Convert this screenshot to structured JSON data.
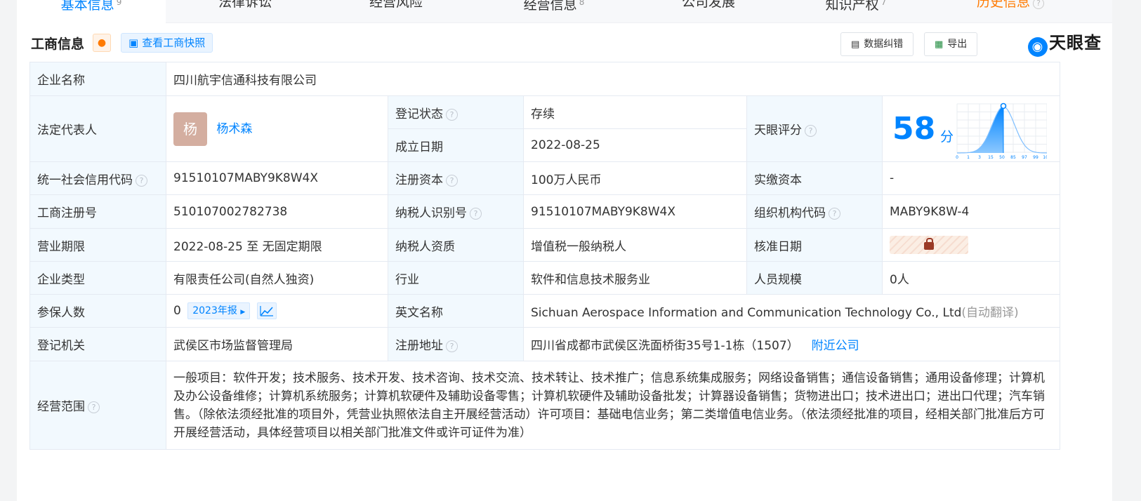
{
  "tabs": [
    {
      "label": "基本信息",
      "count": "9"
    },
    {
      "label": "法律诉讼",
      "count": ""
    },
    {
      "label": "经营风险",
      "count": ""
    },
    {
      "label": "经营信息",
      "count": "8"
    },
    {
      "label": "公司发展",
      "count": ""
    },
    {
      "label": "知识产权",
      "count": "7"
    },
    {
      "label": "历史信息",
      "count": ""
    }
  ],
  "header": {
    "title": "工商信息",
    "snapshot_label": "查看工商快照",
    "correct_label": "数据纠错",
    "export_label": "导出",
    "logo_text": "天眼查"
  },
  "help_glyph": "?",
  "rows": {
    "company_name": {
      "label": "企业名称",
      "value": "四川航宇信通科技有限公司"
    },
    "legal_rep": {
      "label": "法定代表人",
      "avatar_char": "杨",
      "name": "杨术森"
    },
    "reg_status": {
      "label": "登记状态",
      "value": "存续"
    },
    "found_date": {
      "label": "成立日期",
      "value": "2022-08-25"
    },
    "tianyan_score": {
      "label": "天眼评分",
      "score": "58",
      "unit": "分",
      "ticks": [
        "0",
        "1",
        "3",
        "15",
        "50",
        "85",
        "97",
        "99",
        "100"
      ]
    },
    "credit_code": {
      "label": "统一社会信用代码",
      "value": "91510107MABY9K8W4X"
    },
    "reg_capital": {
      "label": "注册资本",
      "value": "100万人民币"
    },
    "paid_capital": {
      "label": "实缴资本",
      "value": "-"
    },
    "biz_reg_no": {
      "label": "工商注册号",
      "value": "510107002782738"
    },
    "taxpayer_id": {
      "label": "纳税人识别号",
      "value": "91510107MABY9K8W4X"
    },
    "org_code": {
      "label": "组织机构代码",
      "value": "MABY9K8W-4"
    },
    "biz_term": {
      "label": "营业期限",
      "value": "2022-08-25 至 无固定期限"
    },
    "taxpayer_qual": {
      "label": "纳税人资质",
      "value": "增值税一般纳税人"
    },
    "approve_date": {
      "label": "核准日期"
    },
    "company_type": {
      "label": "企业类型",
      "value": "有限责任公司(自然人独资)"
    },
    "industry": {
      "label": "行业",
      "value": "软件和信息技术服务业"
    },
    "staff_size": {
      "label": "人员规模",
      "value": "0人"
    },
    "insured": {
      "label": "参保人数",
      "value": "0",
      "report_tag": "2023年报"
    },
    "english_name": {
      "label": "英文名称",
      "value": "Sichuan Aerospace Information and Communication Technology Co., Ltd",
      "note": "(自动翻译)"
    },
    "reg_authority": {
      "label": "登记机关",
      "value": "武侯区市场监督管理局"
    },
    "reg_address": {
      "label": "注册地址",
      "value": "四川省成都市武侯区洗面桥街35号1-1栋（1507）",
      "nearby": "附近公司"
    },
    "biz_scope": {
      "label": "经营范围",
      "value": "一般项目：软件开发；技术服务、技术开发、技术咨询、技术交流、技术转让、技术推广；信息系统集成服务；网络设备销售；通信设备销售；通用设备修理；计算机及办公设备维修；计算机系统服务；计算机软硬件及辅助设备零售；计算机软硬件及辅助设备批发；计算器设备销售；货物进出口；技术进出口；进出口代理；汽车销售。（除依法须经批准的项目外，凭营业执照依法自主开展经营活动）许可项目：基础电信业务；第二类增值电信业务。（依法须经批准的项目，经相关部门批准后方可开展经营活动，具体经营项目以相关部门批准文件或许可证件为准）"
    }
  },
  "colors": {
    "accent": "#0084ff",
    "status_green": "#18a058",
    "label_bg": "#f2f9fe",
    "history_orange": "#ff7a00"
  }
}
